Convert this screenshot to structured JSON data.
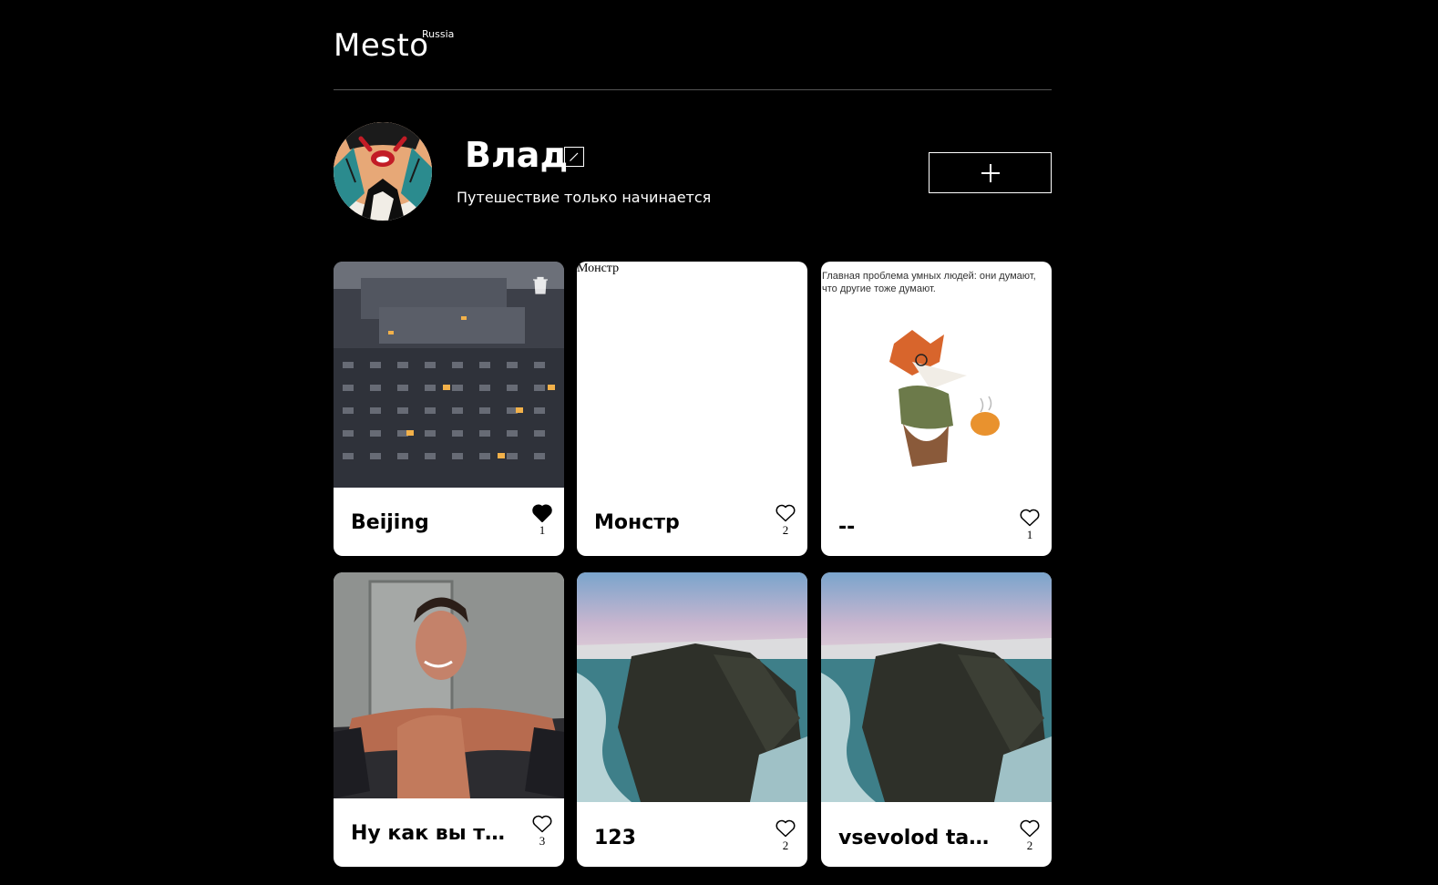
{
  "header": {
    "logo": "Mesto",
    "logo_sup": "Russia"
  },
  "profile": {
    "name": "Влад",
    "about": "Путешествие только начинается"
  },
  "cards": [
    {
      "title": "Beijing",
      "likes": "1",
      "liked": true
    },
    {
      "title": "Монстр",
      "likes": "2",
      "liked": false,
      "alt": "Монстр"
    },
    {
      "title": "--",
      "likes": "1",
      "liked": false,
      "image_text": "Главная проблема умных людей: они думают, что другие тоже думают."
    },
    {
      "title": "Ну как вы там?",
      "likes": "3",
      "liked": false
    },
    {
      "title": "123",
      "likes": "2",
      "liked": false
    },
    {
      "title": "vsevolod tarkovsky",
      "likes": "2",
      "liked": false
    }
  ],
  "colors": {
    "background": "#000000",
    "card": "#ffffff",
    "text": "#ffffff",
    "divider": "#545454"
  },
  "icons": {
    "edit": "pencil-icon",
    "add": "plus-icon",
    "like": "heart-icon",
    "delete": "trash-icon"
  }
}
